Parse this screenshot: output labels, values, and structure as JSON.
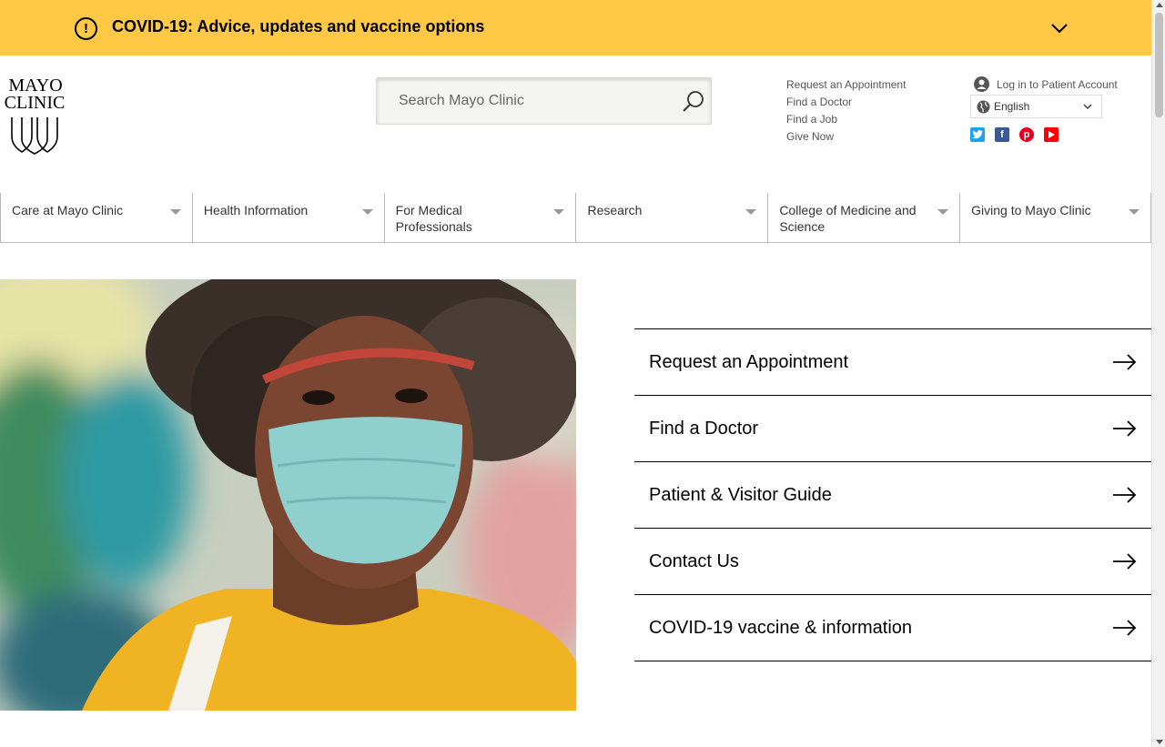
{
  "alert": {
    "text": "COVID-19: Advice, updates and vaccine options",
    "icon": "exclamation-circle-icon",
    "background": "#ffc845"
  },
  "logo": {
    "line1": "MAYO",
    "line2": "CLINIC"
  },
  "search": {
    "placeholder": "Search Mayo Clinic"
  },
  "utility_links": [
    "Request an Appointment",
    "Find a Doctor",
    "Find a Job",
    "Give Now"
  ],
  "account": {
    "login_label": "Log in to Patient Account",
    "language": "English"
  },
  "social": [
    {
      "name": "twitter-icon",
      "color": "#1da1f2"
    },
    {
      "name": "facebook-icon",
      "color": "#3b5998"
    },
    {
      "name": "pinterest-icon",
      "color": "#e60023"
    },
    {
      "name": "youtube-icon",
      "color": "#ff0000"
    }
  ],
  "nav": [
    "Care at Mayo Clinic",
    "Health Information",
    "For Medical Professionals",
    "Research",
    "College of Medicine and Science",
    "Giving to Mayo Clinic"
  ],
  "cta": [
    "Request an Appointment",
    "Find a Doctor",
    "Patient & Visitor Guide",
    "Contact Us",
    "COVID-19 vaccine & information"
  ]
}
